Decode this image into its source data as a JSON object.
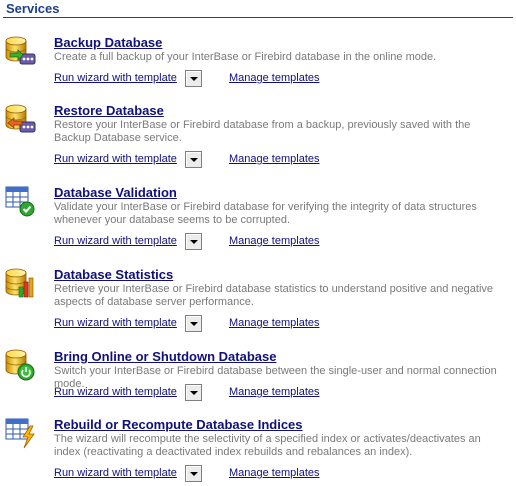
{
  "header": {
    "title": "Services"
  },
  "common": {
    "wizard_label": "Run wizard with template",
    "manage_label": "Manage templates"
  },
  "services": [
    {
      "title": "Backup Database",
      "description": "Create a full backup of your InterBase or Firebird database in the online mode.",
      "icon": "database-backup-icon"
    },
    {
      "title": "Restore Database",
      "description": "Restore your InterBase or Firebird database from a backup, previously saved with the Backup Database service.",
      "icon": "database-restore-icon"
    },
    {
      "title": "Database Validation",
      "description": "Validate your InterBase or Firebird database for verifying the integrity of data structures whenever your database seems to be corrupted.",
      "icon": "table-check-icon"
    },
    {
      "title": "Database Statistics",
      "description": "Retrieve your InterBase or Firebird database statistics to understand positive and negative aspects of database server performance.",
      "icon": "database-statistics-icon"
    },
    {
      "title": "Bring Online or Shutdown Database",
      "description": "Switch your InterBase or Firebird database between the single-user and normal connection mode.",
      "icon": "database-power-icon"
    },
    {
      "title": "Rebuild or Recompute Database Indices",
      "description": "The wizard will recompute the selectivity of a specified index or activates/deactivates an index (reactivating a deactivated index rebuilds and rebalances an index).",
      "icon": "table-lightning-icon"
    }
  ]
}
